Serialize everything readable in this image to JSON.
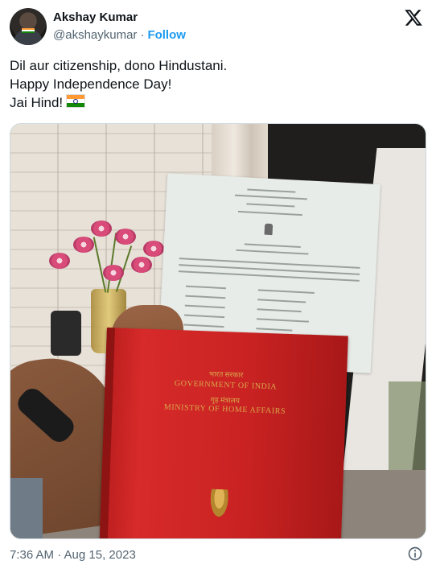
{
  "author": {
    "name": "Akshay Kumar",
    "handle": "@akshaykumar",
    "separator": "·",
    "follow_label": "Follow"
  },
  "tweet": {
    "lines": [
      "Dil aur citizenship, dono Hindustani.",
      "Happy Independence Day!",
      "Jai Hind!"
    ],
    "emoji": "flag-india"
  },
  "media": {
    "book_text": {
      "hindi_title": "भारत सरकार",
      "government": "GOVERNMENT OF INDIA",
      "hindi_ministry": "गृह मंत्रालय",
      "ministry": "MINISTRY OF HOME AFFAIRS"
    }
  },
  "footer": {
    "timestamp": "7:36 AM · Aug 15, 2023"
  },
  "icons": {
    "brand": "x-logo",
    "info": "info-icon"
  },
  "colors": {
    "accent": "#1d9bf0",
    "text_primary": "#0f1419",
    "text_secondary": "#536471",
    "border": "#cfd9de"
  }
}
